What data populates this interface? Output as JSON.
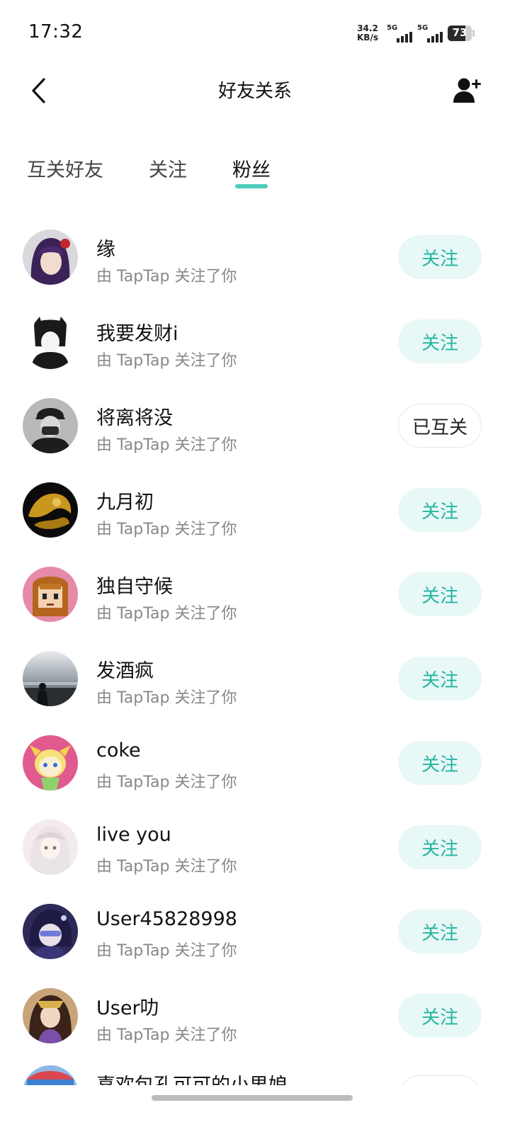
{
  "status_bar": {
    "time": "17:32",
    "net_speed_value": "34.2",
    "net_speed_unit": "KB/s",
    "sim1": "5G",
    "sim2": "5G",
    "battery": "73"
  },
  "header": {
    "title": "好友关系",
    "back_icon": "chevron-left-icon",
    "add_icon": "add-user-icon"
  },
  "tabs": [
    {
      "label": "互关好友",
      "active": false
    },
    {
      "label": "关注",
      "active": false
    },
    {
      "label": "粉丝",
      "active": true
    }
  ],
  "colors": {
    "accent": "#2fc2b0",
    "follow_bg": "#e8f8f6",
    "follow_text": "#25b5a4"
  },
  "followers": [
    {
      "name": "缘",
      "subtitle": "由 TapTap 关注了你",
      "button": "关注",
      "state": "follow"
    },
    {
      "name": "我要发财i",
      "subtitle": "由 TapTap 关注了你",
      "button": "关注",
      "state": "follow"
    },
    {
      "name": "将离将没",
      "subtitle": "由 TapTap 关注了你",
      "button": "已互关",
      "state": "mutual"
    },
    {
      "name": "九月初",
      "subtitle": "由 TapTap 关注了你",
      "button": "关注",
      "state": "follow"
    },
    {
      "name": "独自守候",
      "subtitle": "由 TapTap 关注了你",
      "button": "关注",
      "state": "follow"
    },
    {
      "name": "发酒疯",
      "subtitle": "由 TapTap 关注了你",
      "button": "关注",
      "state": "follow"
    },
    {
      "name": "coke",
      "subtitle": "由 TapTap 关注了你",
      "button": "关注",
      "state": "follow"
    },
    {
      "name": "live you",
      "subtitle": "由 TapTap 关注了你",
      "button": "关注",
      "state": "follow"
    },
    {
      "name": "User45828998",
      "subtitle": "由 TapTap 关注了你",
      "button": "关注",
      "state": "follow"
    },
    {
      "name": "User叻",
      "subtitle": "由 TapTap 关注了你",
      "button": "关注",
      "state": "follow"
    }
  ],
  "partial_row_name": "喜欢包孔可可的小男娘"
}
